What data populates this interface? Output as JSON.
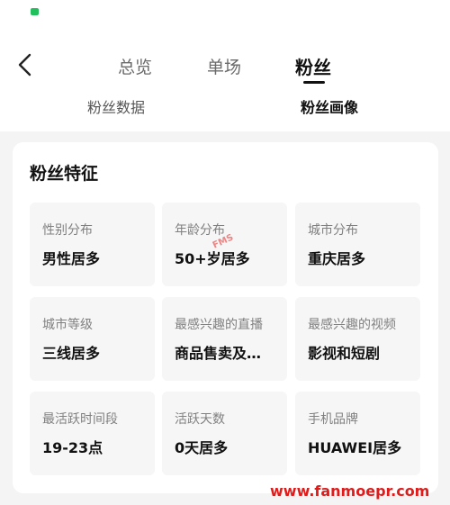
{
  "status_bar": {
    "icon": "wechat-icon"
  },
  "nav": {
    "back_icon": "chevron-left-icon",
    "tabs": [
      {
        "label": "总览"
      },
      {
        "label": "单场"
      },
      {
        "label": "粉丝",
        "active": true
      }
    ],
    "subtabs": [
      {
        "label": "粉丝数据"
      },
      {
        "label": "粉丝画像",
        "active": true
      }
    ]
  },
  "fans_features": {
    "title": "粉丝特征",
    "cells": [
      {
        "label": "性别分布",
        "value": "男性居多"
      },
      {
        "label": "年龄分布",
        "value": "50+岁居多"
      },
      {
        "label": "城市分布",
        "value": "重庆居多"
      },
      {
        "label": "城市等级",
        "value": "三线居多"
      },
      {
        "label": "最感兴趣的直播",
        "value": "商品售卖及…"
      },
      {
        "label": "最感兴趣的视频",
        "value": "影视和短剧"
      },
      {
        "label": "最活跃时间段",
        "value": "19-23点"
      },
      {
        "label": "活跃天数",
        "value": "0天居多"
      },
      {
        "label": "手机品牌",
        "value": "HUAWEI居多"
      }
    ]
  },
  "watermark": {
    "text": "www.fanmoepr.com",
    "mark": "FMS"
  },
  "colors": {
    "accent": "#111111",
    "watermark": "#e11a1a",
    "status_icon": "#20c05c"
  }
}
